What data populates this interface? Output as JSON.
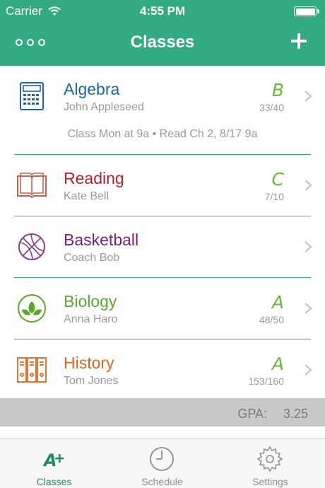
{
  "status_bar": {
    "carrier": "Carrier",
    "time": "4:55 PM"
  },
  "nav": {
    "title": "Classes"
  },
  "classes": [
    {
      "name": "Algebra",
      "teacher": "John Appleseed",
      "grade": "B",
      "score": "33/40",
      "color": "#1a64b0",
      "grade_color": "#6aba3a",
      "icon": "calculator-icon",
      "note": "Class Mon at 9a • Read Ch 2, 8/17 9a"
    },
    {
      "name": "Reading",
      "teacher": "Kate Bell",
      "grade": "C",
      "score": "7/10",
      "color": "#b51f2e",
      "grade_color": "#6aba3a",
      "icon": "book-icon"
    },
    {
      "name": "Basketball",
      "teacher": "Coach Bob",
      "grade": "",
      "score": "",
      "color": "#7a1f7a",
      "grade_color": "#6aba3a",
      "icon": "basketball-icon"
    },
    {
      "name": "Biology",
      "teacher": "Anna Haro",
      "grade": "A",
      "score": "48/50",
      "color": "#5aa82a",
      "grade_color": "#6aba3a",
      "icon": "leaf-icon"
    },
    {
      "name": "History",
      "teacher": "Tom Jones",
      "grade": "A",
      "score": "153/160",
      "color": "#e4661e",
      "grade_color": "#6aba3a",
      "icon": "binders-icon"
    }
  ],
  "gpa": {
    "label": "GPA:",
    "value": "3.25"
  },
  "tabs": [
    {
      "label": "Classes",
      "icon": "a-plus-icon",
      "active": true
    },
    {
      "label": "Schedule",
      "icon": "clock-icon",
      "active": false
    },
    {
      "label": "Settings",
      "icon": "gear-icon",
      "active": false
    }
  ],
  "colors": {
    "accent": "#33ab82",
    "tab_active": "#1e8c66"
  }
}
